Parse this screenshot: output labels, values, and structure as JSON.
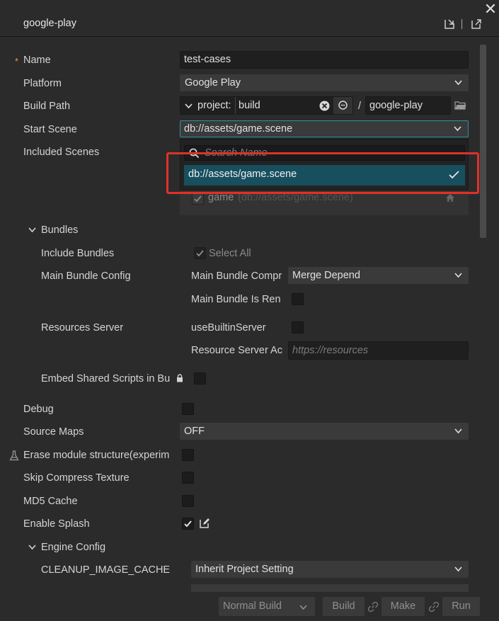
{
  "window": {
    "title": "google-play"
  },
  "form": {
    "name": {
      "label": "Name",
      "value": "test-cases"
    },
    "platform": {
      "label": "Platform",
      "value": "Google Play"
    },
    "build_path": {
      "label": "Build Path",
      "prefix": "project:",
      "value": "build",
      "separator": "/",
      "folder": "google-play"
    },
    "start_scene": {
      "label": "Start Scene",
      "value": "db://assets/game.scene"
    },
    "included_scenes": {
      "label": "Included Scenes",
      "scene_name": "game",
      "scene_path": "(db://assets/game.scene)"
    },
    "dropdown": {
      "search_placeholder": "Search Name",
      "item": "db://assets/game.scene"
    },
    "bundles": {
      "label": "Bundles",
      "include_label": "Include Bundles",
      "select_all": "Select All",
      "main_config_label": "Main Bundle Config",
      "compression_label": "Main Bundle Compr",
      "compression_value": "Merge Depend",
      "is_remote_label": "Main Bundle Is Ren",
      "resources_server_label": "Resources Server",
      "use_builtin_label": "useBuiltinServer",
      "server_address_label": "Resource Server Ac",
      "server_address_placeholder": "https://resources",
      "embed_label": "Embed Shared Scripts in Bu"
    },
    "debug": {
      "label": "Debug"
    },
    "source_maps": {
      "label": "Source Maps",
      "value": "OFF"
    },
    "erase_module": {
      "label": "Erase module structure(experim"
    },
    "skip_compress": {
      "label": "Skip Compress Texture"
    },
    "md5_cache": {
      "label": "MD5 Cache"
    },
    "enable_splash": {
      "label": "Enable Splash",
      "checked": true
    },
    "engine_config": {
      "label": "Engine Config",
      "cleanup_label": "CLEANUP_IMAGE_CACHE",
      "cleanup_value": "Inherit Project Setting"
    }
  },
  "footer": {
    "build_mode": "Normal Build",
    "build": "Build",
    "make": "Make",
    "run": "Run"
  },
  "colors": {
    "accent": "#174f5f",
    "highlight_box": "#e0302a",
    "required": "#e0a030"
  }
}
